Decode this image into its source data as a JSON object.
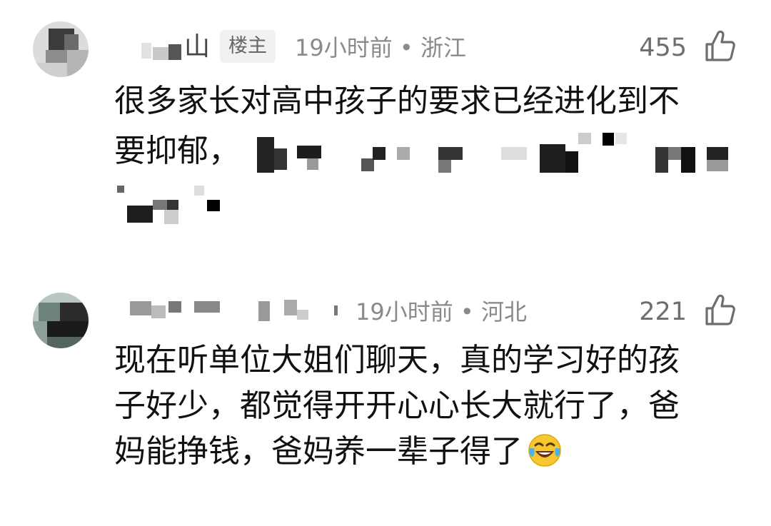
{
  "comments": [
    {
      "author_visible": "山",
      "badge": "楼主",
      "meta": "19小时前 • 浙江",
      "likes": "455",
      "text_line1": "很多家长对高中孩子的要求已经进化到不",
      "text_line2_prefix": "要抑郁，"
    },
    {
      "meta": "19小时前 • 河北",
      "likes": "221",
      "text_lines": [
        "现在听单位大姐们聊天，真的学习好的孩",
        "子好少，都觉得开开心心长大就行了，爸",
        "妈能挣钱，爸妈养一辈子得了"
      ],
      "emoji": "laughing-tears-emoji"
    }
  ],
  "icons": {
    "like": "thumbs-up-icon"
  },
  "colors": {
    "meta_text": "#8a8a8a",
    "badge_bg": "#f1f1f1",
    "body_text": "#111111"
  }
}
